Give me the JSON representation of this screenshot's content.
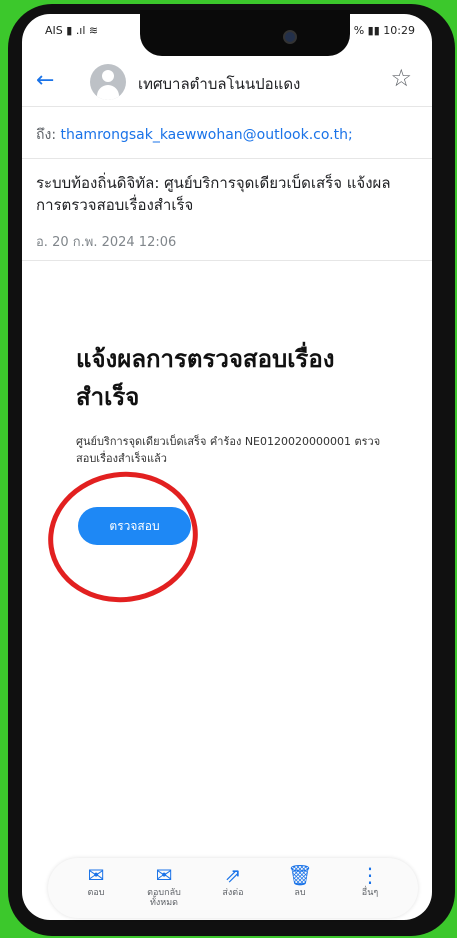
{
  "status_bar": {
    "carrier": "AIS",
    "left_icons": "▮ .ıl ≋",
    "battery": "% ▮▮ 10:29"
  },
  "header": {
    "sender": "เทศบาลตำบลโนนปอแดง",
    "back_icon": "arrow-back-icon",
    "star_icon": "star-outline-icon"
  },
  "email": {
    "to_label": "ถึง:",
    "to_address": "thamrongsak_kaewwohan@outlook.co.th;",
    "subject": "ระบบท้องถิ่นดิจิทัล: ศูนย์บริการจุดเดียวเบ็ดเสร็จ แจ้งผลการตรวจสอบเรื่องสำเร็จ",
    "date": "อ. 20 ก.พ. 2024 12:06"
  },
  "message": {
    "title": "แจ้งผลการตรวจสอบเรื่องสำเร็จ",
    "text": "ศูนย์บริการจุดเดียวเบ็ดเสร็จ คำร้อง NE0120020000001 ตรวจสอบเรื่องสำเร็จแล้ว",
    "button_label": "ตรวจสอบ"
  },
  "actions": [
    {
      "label": "ตอบ",
      "icon": "reply-icon"
    },
    {
      "label": "ตอบกลับทั้งหมด",
      "icon": "reply-all-icon"
    },
    {
      "label": "ส่งต่อ",
      "icon": "forward-icon"
    },
    {
      "label": "ลบ",
      "icon": "trash-icon"
    },
    {
      "label": "อื่นๆ",
      "icon": "more-icon"
    }
  ],
  "colors": {
    "accent": "#1a73e8",
    "button": "#1e88f5",
    "highlight_circle": "#e22020",
    "background": "#3cc82c"
  }
}
